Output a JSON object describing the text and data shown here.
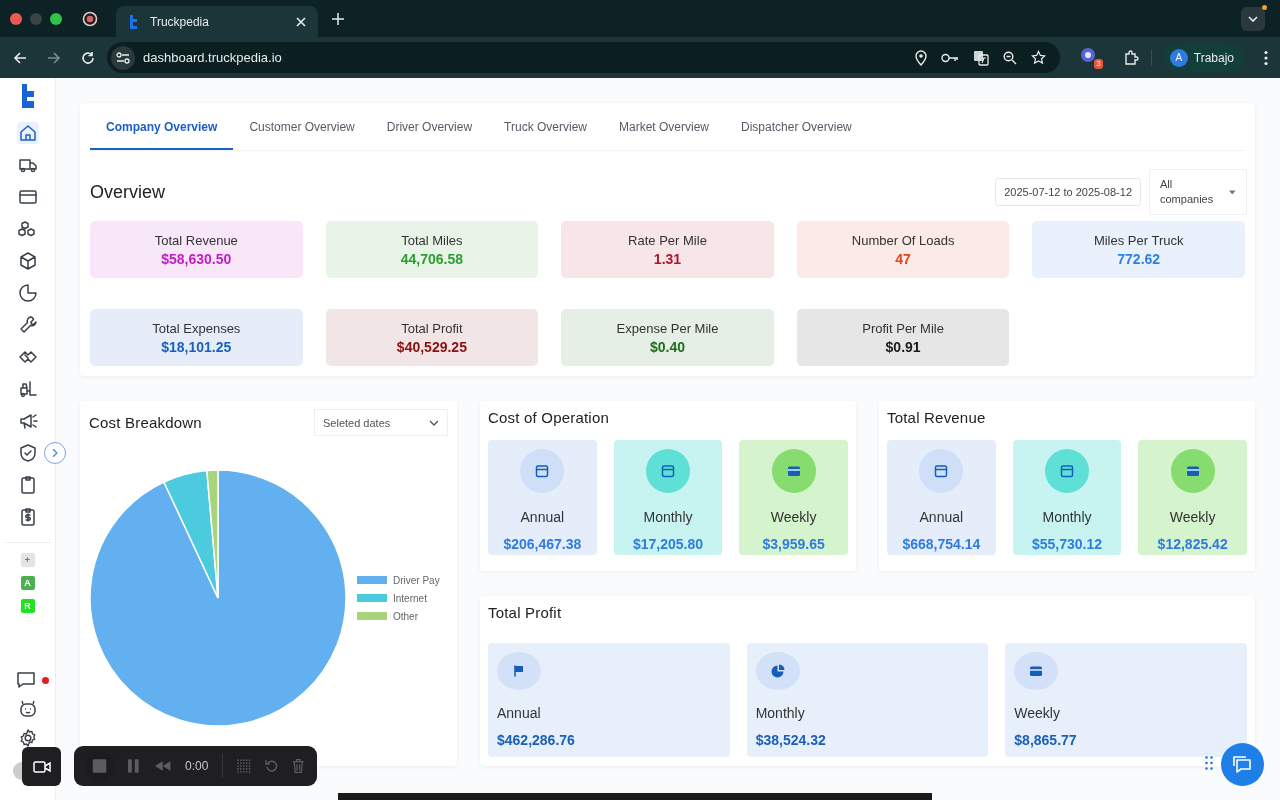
{
  "browser": {
    "tabs": [
      {
        "title": "Truckpedia",
        "selected": true
      }
    ],
    "url": "dashboard.truckpedia.io",
    "extension_badge": "3",
    "profile_initial": "A",
    "profile_name": "Trabajo"
  },
  "sidebar": {
    "items": [
      {
        "selected": true
      },
      {
        "selected": false
      },
      {
        "selected": false
      },
      {
        "selected": false
      },
      {
        "selected": false
      },
      {
        "selected": false
      },
      {
        "selected": false
      },
      {
        "selected": false
      },
      {
        "selected": false
      },
      {
        "selected": false
      },
      {
        "selected": false
      },
      {
        "selected": false
      },
      {
        "selected": false
      }
    ],
    "workspaces": [
      {
        "label": "+",
        "color": "#e4e4e4"
      },
      {
        "label": "A",
        "color": "#4caf50"
      },
      {
        "label": "R",
        "color": "#22e022"
      }
    ],
    "chat_unread": true
  },
  "tabs": [
    {
      "label": "Company Overview",
      "selected": true
    },
    {
      "label": "Customer Overview",
      "selected": false
    },
    {
      "label": "Driver Overview",
      "selected": false
    },
    {
      "label": "Truck Overview",
      "selected": false
    },
    {
      "label": "Market Overview",
      "selected": false
    },
    {
      "label": "Dispatcher Overview",
      "selected": false
    }
  ],
  "overview": {
    "title": "Overview",
    "date_range": "2025-07-12 to 2025-08-12",
    "company_select": "All companies",
    "stats": [
      {
        "label": "Total Revenue",
        "value": "$58,630.50",
        "color": "#c21cc8"
      },
      {
        "label": "Total Miles",
        "value": "44,706.58",
        "color": "#2e9e2e"
      },
      {
        "label": "Rate Per Mile",
        "value": "1.31",
        "color": "#b3122e"
      },
      {
        "label": "Number Of Loads",
        "value": "47",
        "color": "#e5421e"
      },
      {
        "label": "Miles Per Truck",
        "value": "772.62",
        "color": "#2f80e0"
      },
      {
        "label": "Total Expenses",
        "value": "$18,101.25",
        "color": "#1a5fc0"
      },
      {
        "label": "Total Profit",
        "value": "$40,529.25",
        "color": "#8b1010"
      },
      {
        "label": "Expense Per Mile",
        "value": "$0.40",
        "color": "#1e6e1e"
      },
      {
        "label": "Profit Per Mile",
        "value": "$0.91",
        "color": "#1a1a1a"
      }
    ]
  },
  "cost_breakdown": {
    "title": "Cost Breakdown",
    "date_select": "Seleted dates",
    "legend": [
      {
        "label": "Driver Pay",
        "color": "#62b0f0"
      },
      {
        "label": "Internet",
        "color": "#4ccbdf"
      },
      {
        "label": "Other",
        "color": "#a8d47e"
      }
    ]
  },
  "cost_of_operation": {
    "title": "Cost of Operation",
    "items": [
      {
        "label": "Annual",
        "value": "$206,467.38",
        "color": "#cfdff8"
      },
      {
        "label": "Monthly",
        "value": "$17,205.80",
        "color": "#5ee0d6"
      },
      {
        "label": "Weekly",
        "value": "$3,959.65",
        "color": "#86dc6e"
      }
    ]
  },
  "total_revenue": {
    "title": "Total Revenue",
    "items": [
      {
        "label": "Annual",
        "value": "$668,754.14",
        "color": "#cfdff8"
      },
      {
        "label": "Monthly",
        "value": "$55,730.12",
        "color": "#5ee0d6"
      },
      {
        "label": "Weekly",
        "value": "$12,825.42",
        "color": "#86dc6e"
      }
    ]
  },
  "total_profit": {
    "title": "Total Profit",
    "items": [
      {
        "label": "Annual",
        "value": "$462,286.76",
        "color": "#d3e1f8"
      },
      {
        "label": "Monthly",
        "value": "$38,524.32",
        "color": "#d3e1f8"
      },
      {
        "label": "Weekly",
        "value": "$8,865.77",
        "color": "#d3e1f8"
      }
    ]
  },
  "recorder": {
    "time": "0:00"
  }
}
